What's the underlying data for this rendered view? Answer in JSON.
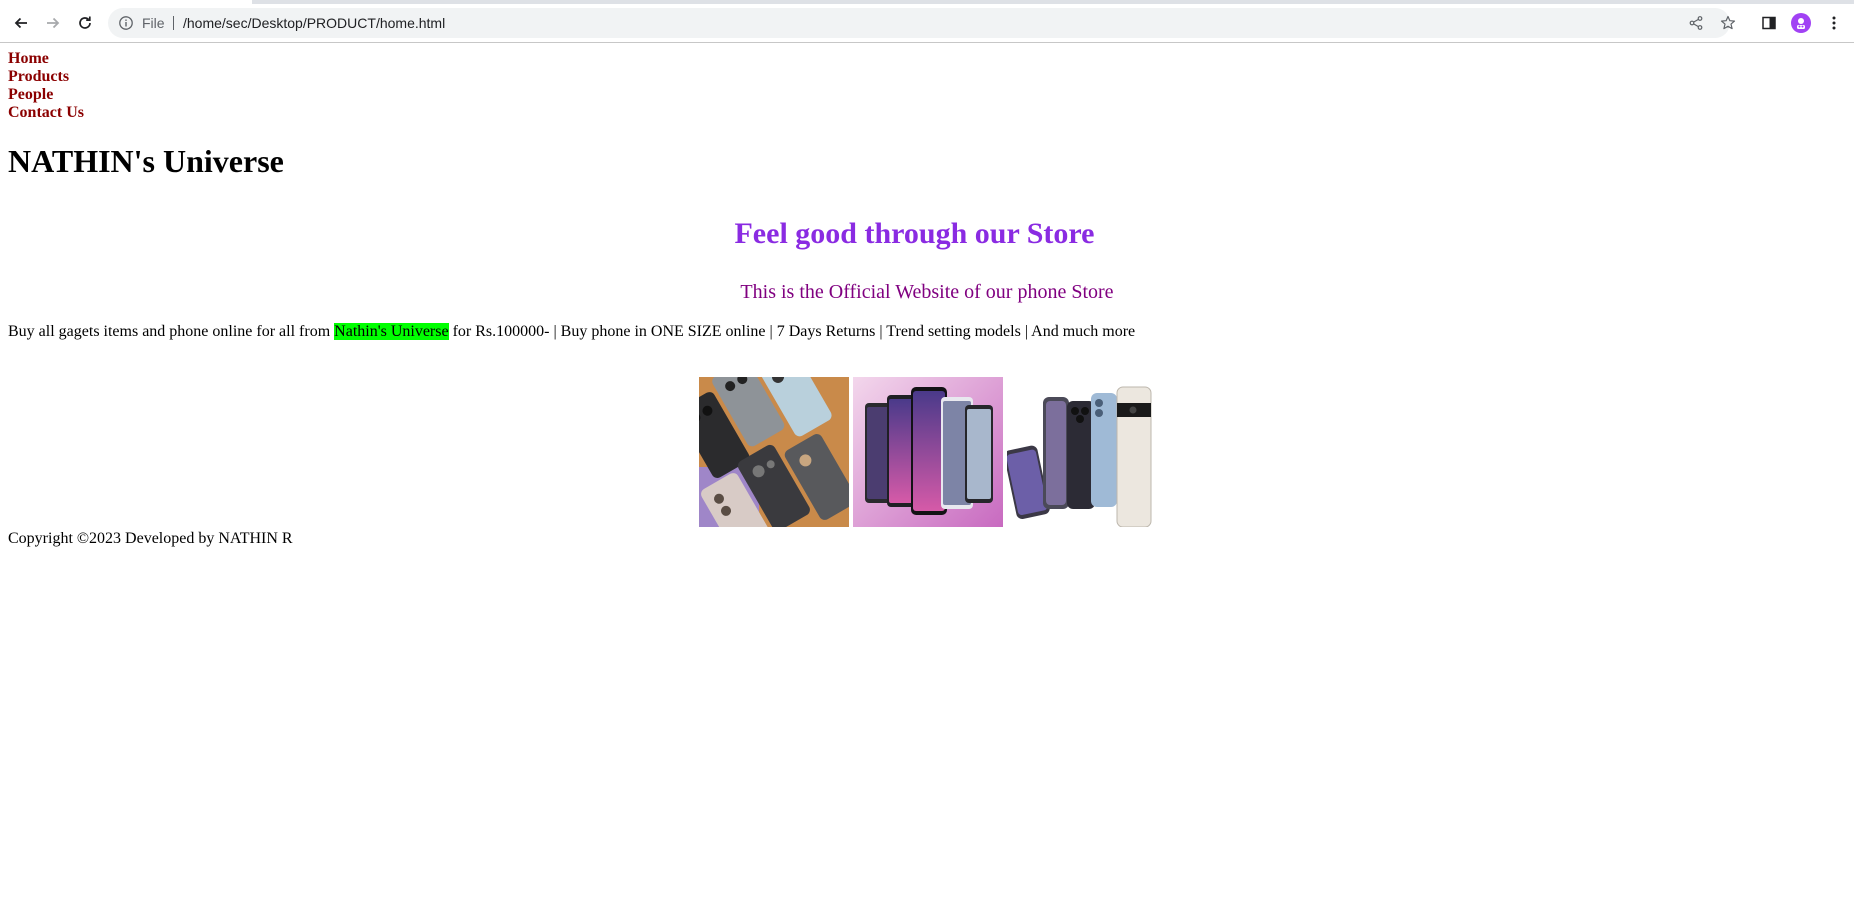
{
  "browser": {
    "scheme_label": "File",
    "url": "/home/sec/Desktop/PRODUCT/home.html",
    "icons": {
      "back": "arrow-left-icon",
      "forward": "arrow-right-icon",
      "reload": "reload-icon",
      "info": "info-icon",
      "share": "share-icon",
      "bookmark": "star-icon",
      "side_panel": "side-panel-icon",
      "profile": "avatar",
      "menu": "kebab-menu-icon"
    }
  },
  "page": {
    "nav": [
      "Home",
      "Products",
      "People",
      "Contact Us"
    ],
    "site_title": "NATHIN's Universe",
    "tagline": "Feel good through our Store",
    "official_line": "This is the Official Website of our phone Store",
    "promo": {
      "before": "Buy all gagets items and phone online for all from ",
      "highlight": "Nathin's Universe",
      "after": " for Rs.100000- | Buy phone in ONE SIZE online | 7 Days Returns | Trend setting models | And much more"
    },
    "images": [
      "phone-collage-image",
      "phone-lineup-pink-image",
      "phone-lineup-white-image"
    ],
    "copyright": "Copyright ©2023 Developed by NATHIN R"
  },
  "colors": {
    "nav_link": "#8b0000",
    "tagline": "#8a2be2",
    "official": "#800080",
    "highlight": "#00ff00",
    "avatar": "#a142f4"
  }
}
